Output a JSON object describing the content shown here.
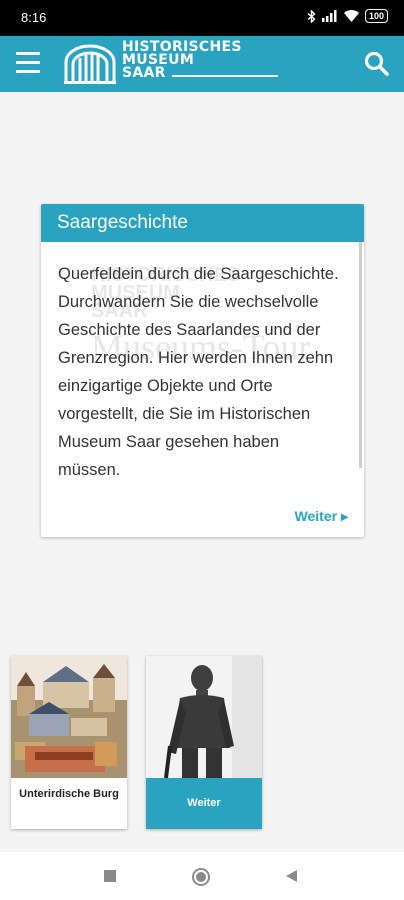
{
  "status_bar": {
    "time": "8:16",
    "battery": "100"
  },
  "app_bar": {
    "logo_line1": "HISTORISCHES",
    "logo_line2": "MUSEUM",
    "logo_line3": "SAAR",
    "menu_icon": "hamburger-menu-icon",
    "search_icon": "search-icon"
  },
  "card": {
    "title": "Saargeschichte",
    "text": "Querfeldein durch die Saargeschichte. Durchwandern Sie die wechselvolle Geschichte des Saarlandes und der Grenzregion. Hier werden Ihnen zehn einzigartige Objekte und Orte vorgestellt, die Sie im Historischen Museum Saar gesehen haben müssen.",
    "watermark_line1": "HISTORISCHES",
    "watermark_line2": "MUSEUM",
    "watermark_line3": "SAAR",
    "watermark_line4": "Museums-Tour",
    "more_label": "Weiter ▸"
  },
  "tiles": [
    {
      "label": "Unterirdische Burg",
      "image": "castle-model-image"
    },
    {
      "label": "Weiter",
      "image": "armored-statue-image"
    }
  ],
  "nav_bar": {
    "icons": [
      "recent-apps-icon",
      "home-icon",
      "back-icon"
    ]
  },
  "colors": {
    "accent": "#2aa3c1",
    "background": "#f4f4f4"
  }
}
